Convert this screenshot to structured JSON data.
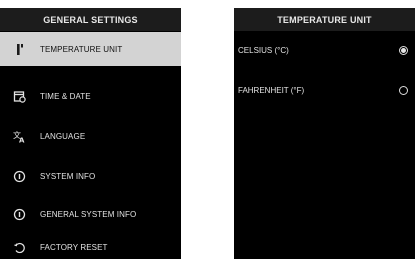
{
  "left_panel": {
    "title": "GENERAL SETTINGS",
    "items": [
      {
        "label": "TEMPERATURE UNIT",
        "icon": "thermometer-icon",
        "selected": true
      },
      {
        "label": "TIME & DATE",
        "icon": "calendar-clock-icon",
        "selected": false
      },
      {
        "label": "LANGUAGE",
        "icon": "translate-icon",
        "selected": false
      },
      {
        "label": "SYSTEM INFO",
        "icon": "info-icon",
        "selected": false
      },
      {
        "label": "GENERAL SYSTEM INFO",
        "icon": "info-icon",
        "selected": false
      },
      {
        "label": "FACTORY RESET",
        "icon": "reset-icon",
        "selected": false
      }
    ]
  },
  "right_panel": {
    "title": "TEMPERATURE UNIT",
    "options": [
      {
        "label": "CELSIUS (°C)",
        "checked": true
      },
      {
        "label": "FAHRENHEIT (°F)",
        "checked": false
      }
    ]
  },
  "colors": {
    "screen_bg": "#000000",
    "header_bg": "#1c1c1c",
    "selected_bg": "#d3d3d3",
    "text": "#e3e3e3"
  }
}
